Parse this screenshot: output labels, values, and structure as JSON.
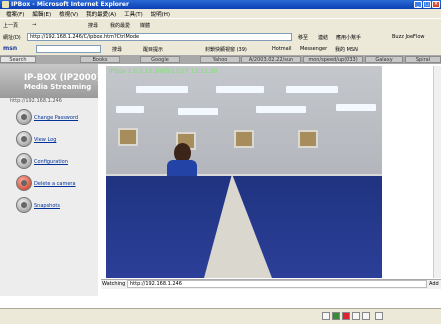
{
  "window": {
    "title": "IPBox - Microsoft Internet Explorer",
    "controls": [
      "_",
      "□",
      "×"
    ]
  },
  "menu": [
    "檔案(F)",
    "編輯(E)",
    "檢視(V)",
    "我的最愛(A)",
    "工具(T)",
    "說明(H)"
  ],
  "toolbar": {
    "back": "上一頁",
    "forward": "→",
    "search": "搜尋",
    "favorites": "我的最愛",
    "media": "媒體"
  },
  "address": {
    "label": "網址(D)",
    "value": "http://192.168.1.246/C/ipbox.htm?CtrlMode",
    "go": "移至",
    "links": "連結",
    "extra": "應用小幫手",
    "ext": "Buzz JoeFlow"
  },
  "msn": {
    "label": "msn",
    "search": "搜尋",
    "highlight": "醒目提示",
    "hotmail": "Hotmail",
    "messenger": "Messenger",
    "mymsn": "我的 MSN",
    "block": "封鎖快顯視窗 (39)"
  },
  "tabs": [
    "Search",
    "Books",
    "Google",
    "Yahoo",
    "A/2003.02.22/sun",
    "mon/speed/up(033)",
    "Galaxy",
    "Spiral"
  ],
  "sidebar": {
    "brand_line1": "IP-BOX (IP2000)",
    "brand_line2": "Media Streaming",
    "ip": "http://192.168.1.246",
    "items": [
      {
        "label": "Change Password"
      },
      {
        "label": "View Log"
      },
      {
        "label": "Configuration"
      },
      {
        "label": "Delete a camera"
      },
      {
        "label": "Snapshots"
      }
    ]
  },
  "video": {
    "osd": "IPBox 1.0.1.12  2005/11/27 13:51:20"
  },
  "watching": {
    "label": "Watching",
    "value": "http://192.168.1.246",
    "add": "Add"
  },
  "status": {
    "icons": [
      "globe-icon",
      "lock-icon",
      "zone-icon",
      "shield-icon",
      "media-icon",
      "page-icon"
    ]
  }
}
